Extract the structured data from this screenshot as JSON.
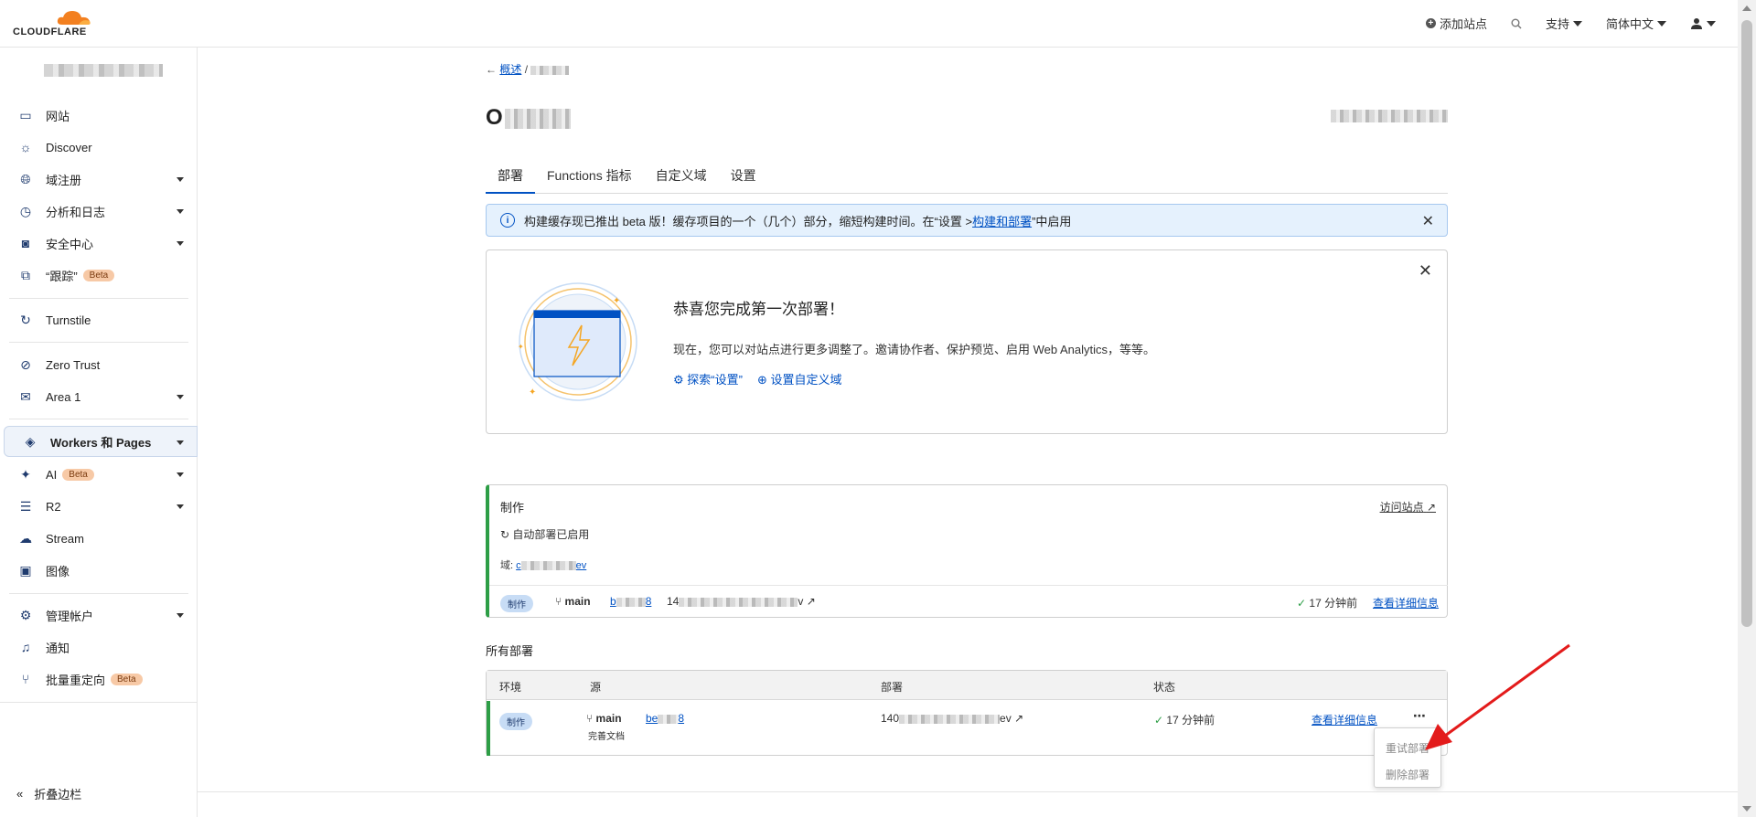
{
  "brand": {
    "name": "CLOUDFLARE",
    "accent": "#f38020"
  },
  "topnav": {
    "add_site": "添加站点",
    "support": "支持",
    "language": "简体中文"
  },
  "sidebar": {
    "items": [
      {
        "label": "网站"
      },
      {
        "label": "Discover"
      },
      {
        "label": "域注册"
      },
      {
        "label": "分析和日志"
      },
      {
        "label": "安全中心"
      },
      {
        "label": "“跟踪”",
        "badge": "Beta"
      },
      {
        "label": "Turnstile"
      },
      {
        "label": "Zero Trust"
      },
      {
        "label": "Area 1"
      },
      {
        "label": "Workers 和 Pages"
      },
      {
        "label": "AI",
        "badge": "Beta"
      },
      {
        "label": "R2"
      },
      {
        "label": "Stream"
      },
      {
        "label": "图像"
      },
      {
        "label": "管理帐户"
      },
      {
        "label": "通知"
      },
      {
        "label": "批量重定向",
        "badge": "Beta"
      }
    ],
    "collapse": "折叠边栏"
  },
  "breadcrumb": {
    "back": "概述",
    "sep": "/"
  },
  "page": {
    "title_initial": "O"
  },
  "tabs": [
    "部署",
    "Functions 指标",
    "自定义域",
    "设置"
  ],
  "banner": {
    "text_before": "构建缓存现已推出 beta 版！缓存项目的一个（几个）部分，缩短构建时间。在“设置 > ",
    "link": "构建和部署",
    "text_after": "”中启用"
  },
  "congrats": {
    "title": "恭喜您完成第一次部署！",
    "body": "现在，您可以对站点进行更多调整了。邀请协作者、保护预览、启用 Web Analytics，等等。",
    "link_settings": "探索“设置”",
    "link_domain": "设置自定义域"
  },
  "production": {
    "label": "制作",
    "visit": "访问站点",
    "auto_deploy": "自动部署已启用",
    "domain_label": "域:",
    "domain_prefix": "c",
    "domain_suffix": "ev",
    "pill": "制作",
    "branch": "main",
    "commit_prefix": "b",
    "commit_suffix": "8",
    "url_prefix": "14",
    "url_suffix": "v",
    "time": "17 分钟前",
    "details": "查看详细信息"
  },
  "all_deployments": {
    "title": "所有部署",
    "columns": [
      "环境",
      "源",
      "部署",
      "状态"
    ],
    "rows": [
      {
        "env": "制作",
        "branch": "main",
        "commit_prefix": "be",
        "commit_suffix": "8",
        "message": "完善文档",
        "url_prefix": "140",
        "url_suffix": "ev",
        "time": "17 分钟前",
        "details": "查看详细信息"
      }
    ]
  },
  "context_menu": {
    "retry": "重试部署",
    "delete": "删除部署"
  }
}
